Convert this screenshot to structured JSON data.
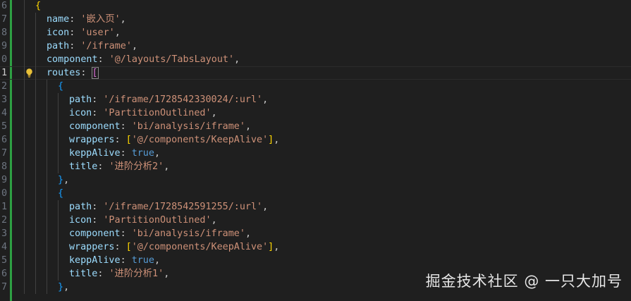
{
  "editor": {
    "lines": [
      {
        "n": "6",
        "indent": 1,
        "code": [
          {
            "t": "{",
            "c": "b1"
          }
        ]
      },
      {
        "n": "7",
        "indent": 2,
        "code": [
          {
            "t": "name",
            "c": "key"
          },
          {
            "t": ": ",
            "c": "pun"
          },
          {
            "t": "'嵌入页'",
            "c": "str"
          },
          {
            "t": ",",
            "c": "pun"
          }
        ]
      },
      {
        "n": "8",
        "indent": 2,
        "code": [
          {
            "t": "icon",
            "c": "key"
          },
          {
            "t": ": ",
            "c": "pun"
          },
          {
            "t": "'user'",
            "c": "str"
          },
          {
            "t": ",",
            "c": "pun"
          }
        ]
      },
      {
        "n": "9",
        "indent": 2,
        "code": [
          {
            "t": "path",
            "c": "key"
          },
          {
            "t": ": ",
            "c": "pun"
          },
          {
            "t": "'/iframe'",
            "c": "str"
          },
          {
            "t": ",",
            "c": "pun"
          }
        ]
      },
      {
        "n": "0",
        "indent": 2,
        "code": [
          {
            "t": "component",
            "c": "key"
          },
          {
            "t": ": ",
            "c": "pun"
          },
          {
            "t": "'@/layouts/TabsLayout'",
            "c": "str"
          },
          {
            "t": ",",
            "c": "pun"
          }
        ]
      },
      {
        "n": "1",
        "indent": 2,
        "active": true,
        "bulb": true,
        "code": [
          {
            "t": "routes",
            "c": "key"
          },
          {
            "t": ": ",
            "c": "pun"
          },
          {
            "t": "[",
            "c": "b2",
            "match": true
          }
        ]
      },
      {
        "n": "2",
        "indent": 3,
        "code": [
          {
            "t": "{",
            "c": "b3"
          }
        ]
      },
      {
        "n": "3",
        "indent": 4,
        "code": [
          {
            "t": "path",
            "c": "key"
          },
          {
            "t": ": ",
            "c": "pun"
          },
          {
            "t": "'/iframe/1728542330024/:url'",
            "c": "str"
          },
          {
            "t": ",",
            "c": "pun"
          }
        ]
      },
      {
        "n": "4",
        "indent": 4,
        "code": [
          {
            "t": "icon",
            "c": "key"
          },
          {
            "t": ": ",
            "c": "pun"
          },
          {
            "t": "'PartitionOutlined'",
            "c": "str"
          },
          {
            "t": ",",
            "c": "pun"
          }
        ]
      },
      {
        "n": "5",
        "indent": 4,
        "code": [
          {
            "t": "component",
            "c": "key"
          },
          {
            "t": ": ",
            "c": "pun"
          },
          {
            "t": "'bi/analysis/iframe'",
            "c": "str"
          },
          {
            "t": ",",
            "c": "pun"
          }
        ]
      },
      {
        "n": "6",
        "indent": 4,
        "code": [
          {
            "t": "wrappers",
            "c": "key"
          },
          {
            "t": ": ",
            "c": "pun"
          },
          {
            "t": "[",
            "c": "b1"
          },
          {
            "t": "'@/components/KeepAlive'",
            "c": "str"
          },
          {
            "t": "]",
            "c": "b1"
          },
          {
            "t": ",",
            "c": "pun"
          }
        ]
      },
      {
        "n": "7",
        "indent": 4,
        "code": [
          {
            "t": "keppAlive",
            "c": "key"
          },
          {
            "t": ": ",
            "c": "pun"
          },
          {
            "t": "true",
            "c": "kw"
          },
          {
            "t": ",",
            "c": "pun"
          }
        ]
      },
      {
        "n": "8",
        "indent": 4,
        "code": [
          {
            "t": "title",
            "c": "key"
          },
          {
            "t": ": ",
            "c": "pun"
          },
          {
            "t": "'进阶分析2'",
            "c": "str"
          },
          {
            "t": ",",
            "c": "pun"
          }
        ]
      },
      {
        "n": "9",
        "indent": 3,
        "code": [
          {
            "t": "}",
            "c": "b3"
          },
          {
            "t": ",",
            "c": "pun"
          }
        ]
      },
      {
        "n": "0",
        "indent": 3,
        "code": [
          {
            "t": "{",
            "c": "b3"
          }
        ]
      },
      {
        "n": "1",
        "indent": 4,
        "code": [
          {
            "t": "path",
            "c": "key"
          },
          {
            "t": ": ",
            "c": "pun"
          },
          {
            "t": "'/iframe/1728542591255/:url'",
            "c": "str"
          },
          {
            "t": ",",
            "c": "pun"
          }
        ]
      },
      {
        "n": "2",
        "indent": 4,
        "code": [
          {
            "t": "icon",
            "c": "key"
          },
          {
            "t": ": ",
            "c": "pun"
          },
          {
            "t": "'PartitionOutlined'",
            "c": "str"
          },
          {
            "t": ",",
            "c": "pun"
          }
        ]
      },
      {
        "n": "3",
        "indent": 4,
        "code": [
          {
            "t": "component",
            "c": "key"
          },
          {
            "t": ": ",
            "c": "pun"
          },
          {
            "t": "'bi/analysis/iframe'",
            "c": "str"
          },
          {
            "t": ",",
            "c": "pun"
          }
        ]
      },
      {
        "n": "4",
        "indent": 4,
        "code": [
          {
            "t": "wrappers",
            "c": "key"
          },
          {
            "t": ": ",
            "c": "pun"
          },
          {
            "t": "[",
            "c": "b1"
          },
          {
            "t": "'@/components/KeepAlive'",
            "c": "str"
          },
          {
            "t": "]",
            "c": "b1"
          },
          {
            "t": ",",
            "c": "pun"
          }
        ]
      },
      {
        "n": "5",
        "indent": 4,
        "code": [
          {
            "t": "keppAlive",
            "c": "key"
          },
          {
            "t": ": ",
            "c": "pun"
          },
          {
            "t": "true",
            "c": "kw"
          },
          {
            "t": ",",
            "c": "pun"
          }
        ]
      },
      {
        "n": "6",
        "indent": 4,
        "code": [
          {
            "t": "title",
            "c": "key"
          },
          {
            "t": ": ",
            "c": "pun"
          },
          {
            "t": "'进阶分析1'",
            "c": "str"
          },
          {
            "t": ",",
            "c": "pun"
          }
        ]
      },
      {
        "n": "7",
        "indent": 3,
        "code": [
          {
            "t": "}",
            "c": "b3"
          },
          {
            "t": ",",
            "c": "pun"
          }
        ]
      }
    ]
  },
  "icons": {
    "bulb": "lightbulb-icon"
  },
  "colors": {
    "background": "#1f1f1f",
    "key": "#9cdcfe",
    "string": "#ce9178",
    "keyword": "#569cd6",
    "bracket1": "#ffd700",
    "bracket2": "#da70d6",
    "bracket3": "#179fff",
    "git_added": "#2ea043"
  },
  "watermark": "掘金技术社区 @ 一只大加号"
}
